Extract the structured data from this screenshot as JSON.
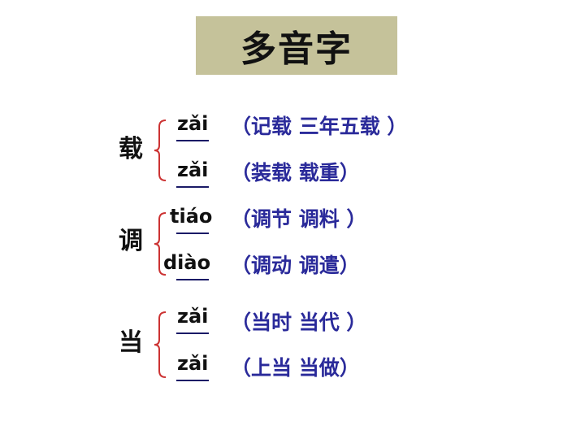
{
  "title": "多音字",
  "colors": {
    "title_bg": "#c5c29a",
    "brace": "#cc3333",
    "words": "#2a2a9a"
  },
  "groups": [
    {
      "char": "载",
      "rows": [
        {
          "pinyin": "zǎi",
          "words": "（记载  三年五载 ）"
        },
        {
          "pinyin": "zǎi",
          "words": "（装载  载重）"
        }
      ]
    },
    {
      "char": "调",
      "rows": [
        {
          "pinyin": "tiáo",
          "words": "（调节  调料 ）"
        },
        {
          "pinyin": "diào",
          "words": "（调动  调遣）"
        }
      ]
    },
    {
      "char": "当",
      "rows": [
        {
          "pinyin": "zǎi",
          "words": "（当时  当代 ）"
        },
        {
          "pinyin": "zǎi",
          "words": "（上当  当做）"
        }
      ]
    }
  ]
}
